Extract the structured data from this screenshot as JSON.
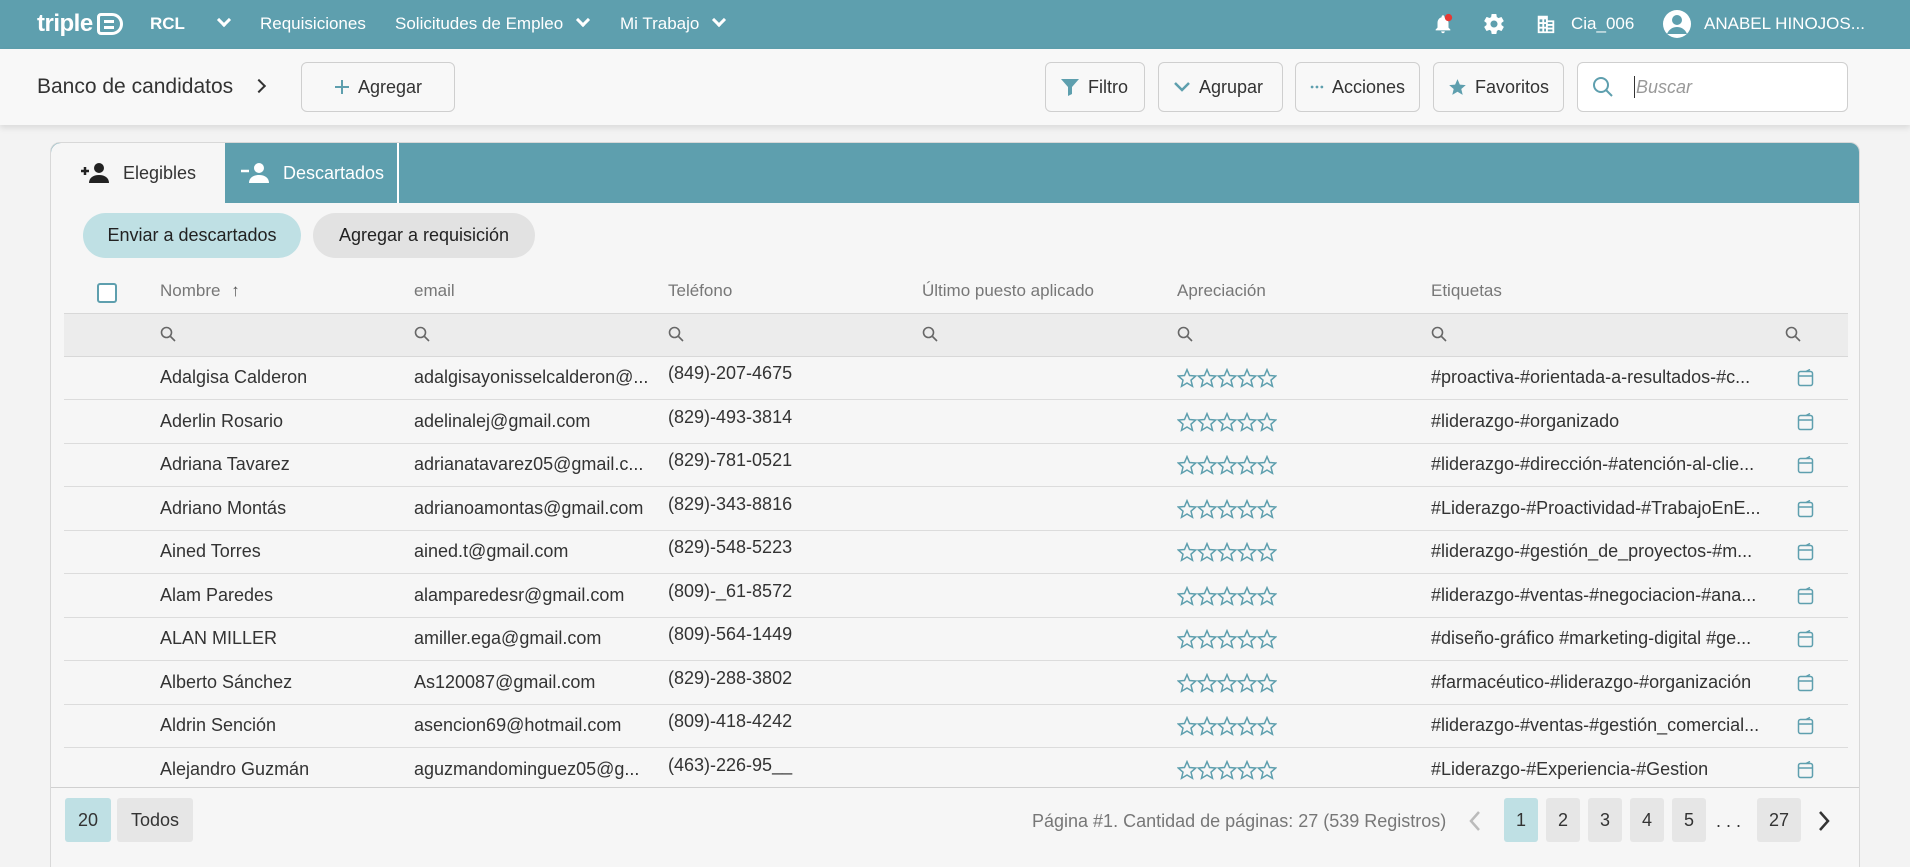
{
  "topbar": {
    "logo_text": "triple",
    "company_menu": "RCL",
    "nav": [
      "Requisiciones",
      "Solicitudes de Empleo",
      "Mi Trabajo"
    ],
    "org": "Cia_006",
    "user": "ANABEL HINOJOS...",
    "bg_color": "#5e9fae",
    "notification_color": "#e53935"
  },
  "toolbar": {
    "breadcrumb": "Banco de candidatos",
    "add_label": "Agregar",
    "filter_label": "Filtro",
    "group_label": "Agrupar",
    "actions_label": "Acciones",
    "favorites_label": "Favoritos",
    "search_placeholder": "Buscar"
  },
  "tabs": [
    {
      "label": "Elegibles",
      "icon": "person-add-icon",
      "active": true
    },
    {
      "label": "Descartados",
      "icon": "person-remove-icon",
      "active": false
    }
  ],
  "actions": {
    "discard_label": "Enviar a descartados",
    "requisition_label": "Agregar a requisición"
  },
  "grid": {
    "columns": [
      "Nombre",
      "email",
      "Teléfono",
      "Último puesto aplicado",
      "Apreciación",
      "Etiquetas"
    ],
    "sort_indicator": "↑",
    "rows": [
      {
        "name": "Adalgisa Calderon",
        "email": "adalgisayonisselcalderon@...",
        "phone": "(849)-207-4675",
        "last_position": "",
        "rating": 0,
        "tags": "#proactiva-#orientada-a-resultados-#c..."
      },
      {
        "name": "Aderlin Rosario",
        "email": "adelinalej@gmail.com",
        "phone": "(829)-493-3814",
        "last_position": "",
        "rating": 0,
        "tags": "#liderazgo-#organizado"
      },
      {
        "name": "Adriana Tavarez",
        "email": "adrianatavarez05@gmail.c...",
        "phone": "(829)-781-0521",
        "last_position": "",
        "rating": 0,
        "tags": "#liderazgo-#dirección-#atención-al-clie..."
      },
      {
        "name": "Adriano Montás",
        "email": "adrianoamontas@gmail.com",
        "phone": "(829)-343-8816",
        "last_position": "",
        "rating": 0,
        "tags": "#Liderazgo-#Proactividad-#TrabajoEnE..."
      },
      {
        "name": "Ained Torres",
        "email": "ained.t@gmail.com",
        "phone": "(829)-548-5223",
        "last_position": "",
        "rating": 0,
        "tags": "#liderazgo-#gestión_de_proyectos-#m..."
      },
      {
        "name": "Alam Paredes",
        "email": "alamparedesr@gmail.com",
        "phone": "(809)-_61-8572",
        "last_position": "",
        "rating": 0,
        "tags": "#liderazgo-#ventas-#negociacion-#ana..."
      },
      {
        "name": "ALAN MILLER",
        "email": "amiller.ega@gmail.com",
        "phone": "(809)-564-1449",
        "last_position": "",
        "rating": 0,
        "tags": "#diseño-gráfico #marketing-digital #ge..."
      },
      {
        "name": "Alberto Sánchez",
        "email": "As120087@gmail.com",
        "phone": "(829)-288-3802",
        "last_position": "",
        "rating": 0,
        "tags": "#farmacéutico-#liderazgo-#organización"
      },
      {
        "name": "Aldrin Sención",
        "email": "asencion69@hotmail.com",
        "phone": "(809)-418-4242",
        "last_position": "",
        "rating": 0,
        "tags": "#liderazgo-#ventas-#gestión_comercial..."
      },
      {
        "name": "Alejandro Guzmán",
        "email": "aguzmandominguez05@g...",
        "phone": "(463)-226-95__",
        "last_position": "",
        "rating": 0,
        "tags": "#Liderazgo-#Experiencia-#Gestion"
      }
    ]
  },
  "pager": {
    "page_size": "20",
    "all_label": "Todos",
    "info": "Página #1. Cantidad de páginas: 27 (539 Registros)",
    "pages": [
      "1",
      "2",
      "3",
      "4",
      "5"
    ],
    "ellipsis": ". . .",
    "last_page": "27"
  }
}
